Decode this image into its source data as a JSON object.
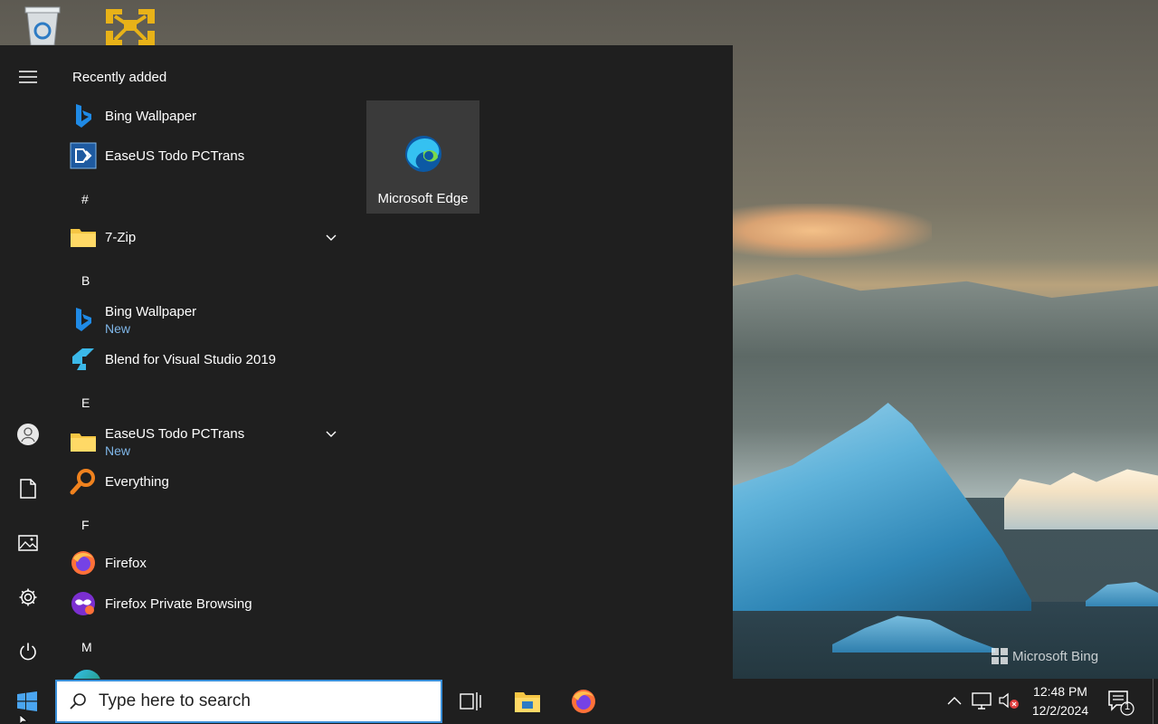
{
  "desktop": {
    "icons": [
      {
        "name": "recycle-bin-icon"
      },
      {
        "name": "vmware-icon"
      }
    ],
    "watermark": "Microsoft Bing"
  },
  "start_menu": {
    "recently_added_title": "Recently added",
    "recent": [
      {
        "label": "Bing Wallpaper",
        "icon": "bing-icon"
      },
      {
        "label": "EaseUS Todo PCTrans",
        "icon": "easeus-icon"
      }
    ],
    "groups": [
      {
        "letter": "#",
        "items": [
          {
            "label": "7-Zip",
            "icon": "folder-icon",
            "expandable": true
          }
        ]
      },
      {
        "letter": "B",
        "items": [
          {
            "label": "Bing Wallpaper",
            "badge": "New",
            "icon": "bing-icon"
          },
          {
            "label": "Blend for Visual Studio 2019",
            "icon": "blend-icon"
          }
        ]
      },
      {
        "letter": "E",
        "items": [
          {
            "label": "EaseUS Todo PCTrans",
            "badge": "New",
            "icon": "folder-icon",
            "expandable": true
          },
          {
            "label": "Everything",
            "icon": "everything-icon"
          }
        ]
      },
      {
        "letter": "F",
        "items": [
          {
            "label": "Firefox",
            "icon": "firefox-icon"
          },
          {
            "label": "Firefox Private Browsing",
            "icon": "firefox-private-icon"
          }
        ]
      },
      {
        "letter": "M",
        "items": []
      }
    ],
    "tile": {
      "label": "Microsoft Edge",
      "icon": "edge-icon"
    }
  },
  "taskbar": {
    "search_placeholder": "Type here to search",
    "clock": {
      "time": "12:48 PM",
      "date": "12/2/2024"
    },
    "notification_count": "1"
  },
  "colors": {
    "accent": "#3a8fd8",
    "menu_bg": "#1f1f1f",
    "new_badge": "#7fb6e8"
  }
}
